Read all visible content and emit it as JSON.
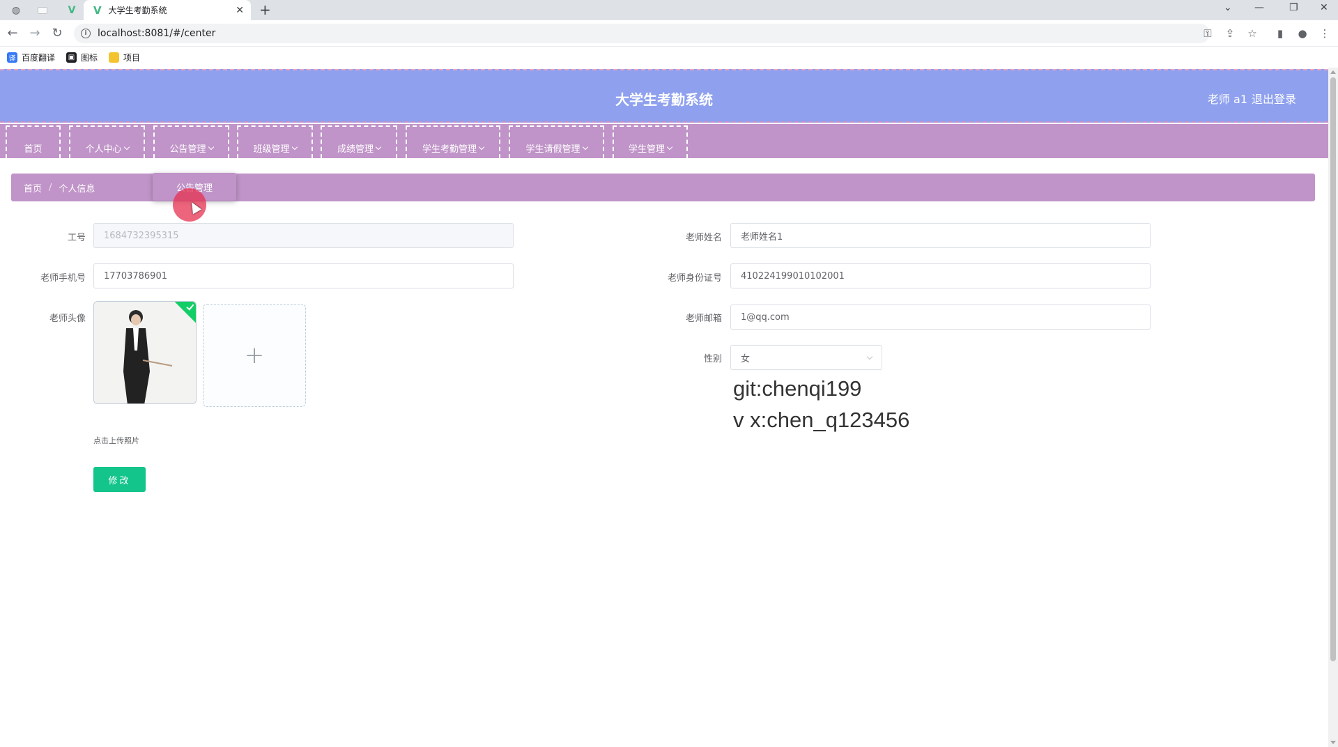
{
  "browser": {
    "tab_title": "大学生考勤系统",
    "url": "localhost:8081/#/center",
    "bookmarks": [
      {
        "label": "百度翻译",
        "icon": "translate-icon",
        "color": "#3478f6"
      },
      {
        "label": "图标",
        "icon": "image-icon",
        "color": "#202124"
      },
      {
        "label": "项目",
        "icon": "folder-icon",
        "color": "#f4c430"
      }
    ]
  },
  "header": {
    "title": "大学生考勤系统",
    "user": "老师 a1",
    "logout": "退出登录",
    "color": "#8ea0ee"
  },
  "nav": {
    "color": "#c094c8",
    "items": [
      {
        "label": "首页",
        "has_dropdown": false
      },
      {
        "label": "个人中心",
        "has_dropdown": true
      },
      {
        "label": "公告管理",
        "has_dropdown": true
      },
      {
        "label": "班级管理",
        "has_dropdown": true
      },
      {
        "label": "成绩管理",
        "has_dropdown": true
      },
      {
        "label": "学生考勤管理",
        "has_dropdown": true
      },
      {
        "label": "学生请假管理",
        "has_dropdown": true
      },
      {
        "label": "学生管理",
        "has_dropdown": true
      }
    ],
    "open_dropdown_item": "公告管理"
  },
  "breadcrumb": {
    "home": "首页",
    "separator": "/",
    "current": "个人信息"
  },
  "form": {
    "job_no": {
      "label": "工号",
      "value": "1684732395315"
    },
    "phone": {
      "label": "老师手机号",
      "value": "17703786901"
    },
    "avatar": {
      "label": "老师头像",
      "hint": "点击上传照片"
    },
    "name": {
      "label": "老师姓名",
      "value": "老师姓名1"
    },
    "id_card": {
      "label": "老师身份证号",
      "value": "410224199010102001"
    },
    "email": {
      "label": "老师邮箱",
      "value": "1@qq.com"
    },
    "gender": {
      "label": "性别",
      "value": "女"
    },
    "submit_label": "修改"
  },
  "overlay": {
    "line1": "git:chenqi199",
    "line2": "v x:chen_q123456"
  },
  "colors": {
    "button_green": "#13c58b",
    "upload_check": "#13ce66"
  }
}
